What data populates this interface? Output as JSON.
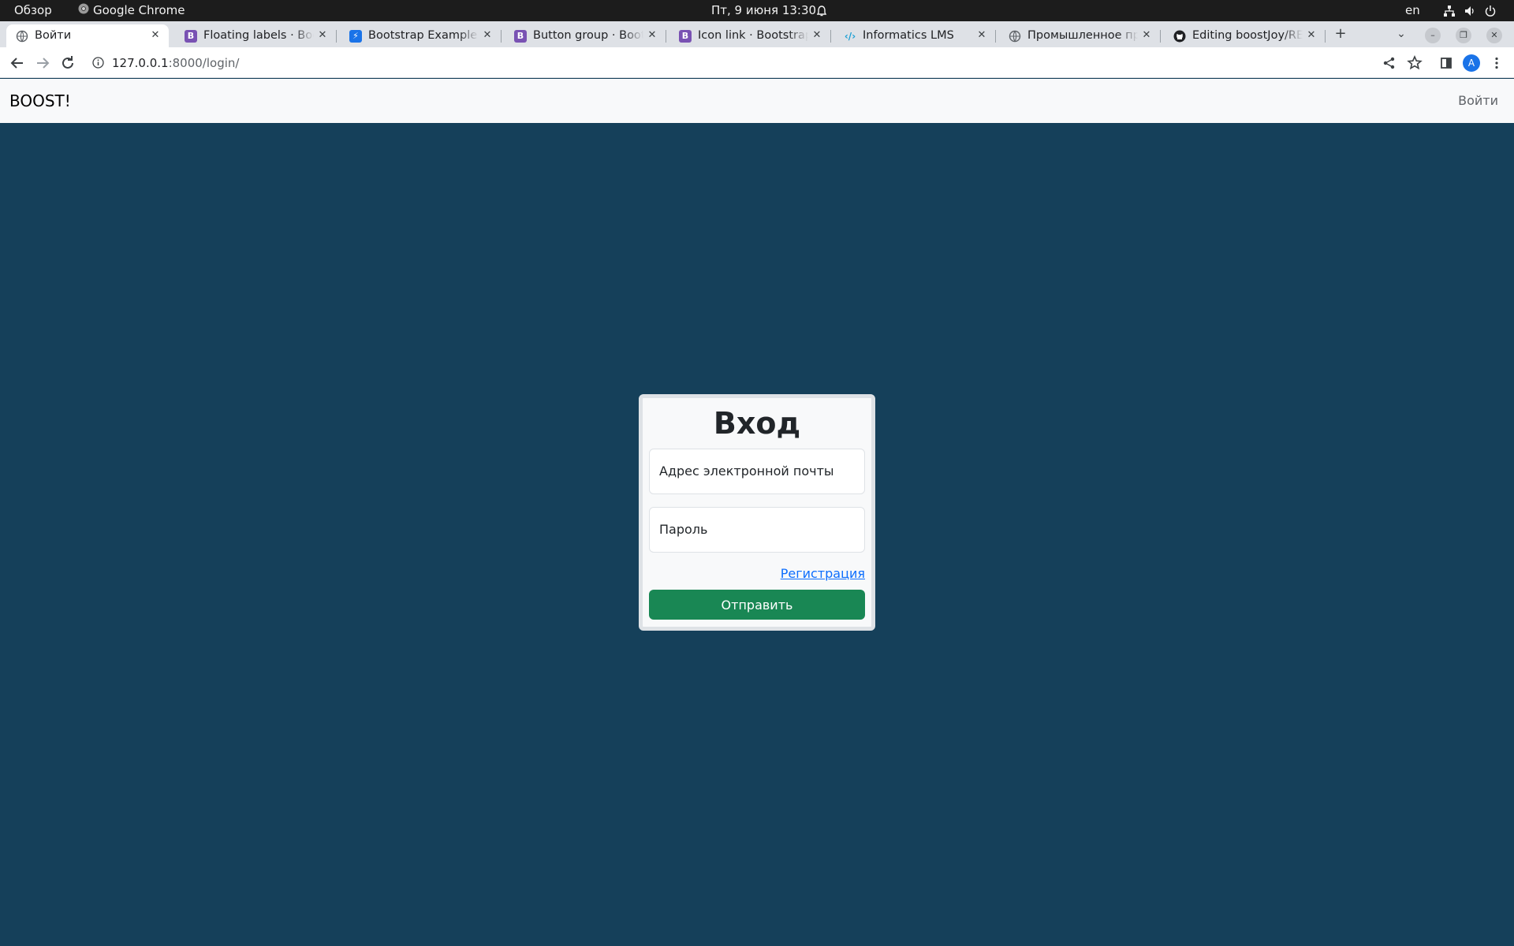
{
  "system_bar": {
    "activities": "Обзор",
    "app_name": "Google Chrome",
    "datetime": "Пт, 9 июня  13:30",
    "language": "en",
    "icons": [
      "chrome-icon",
      "alarm-icon",
      "network-icon",
      "volume-icon",
      "power-icon"
    ]
  },
  "tabs": [
    {
      "title": "Войти",
      "favicon": "globe-icon",
      "active": true
    },
    {
      "title": "Floating labels · Bootstrap",
      "favicon": "bootstrap-icon",
      "favicon_color": "#7952b3"
    },
    {
      "title": "Bootstrap Example - ",
      "favicon": "bolt-icon",
      "favicon_color": "#1a73e8"
    },
    {
      "title": "Button group · Bootstrap",
      "favicon": "bootstrap-icon",
      "favicon_color": "#7952b3"
    },
    {
      "title": "Icon link · Bootstrap v",
      "favicon": "bootstrap-icon",
      "favicon_color": "#7952b3"
    },
    {
      "title": "Informatics LMS",
      "favicon": "code-icon",
      "favicon_color": "#1a9fd4"
    },
    {
      "title": "Промышленное про",
      "favicon": "globe-icon"
    },
    {
      "title": "Editing boostJoy/README",
      "favicon": "github-icon"
    }
  ],
  "toolbar": {
    "url_host": "127.0.0.1",
    "url_rest": ":8000/login/",
    "profile_initial": "A"
  },
  "navbar": {
    "brand": "BOOST!",
    "login_link": "Войти"
  },
  "login_form": {
    "title": "Вход",
    "email_placeholder": "Адрес электронной почты",
    "password_placeholder": "Пароль",
    "register_link": "Регистрация",
    "submit_label": "Отправить"
  },
  "colors": {
    "page_background": "#15405a",
    "submit_button": "#198754",
    "link": "#0d6efd"
  }
}
